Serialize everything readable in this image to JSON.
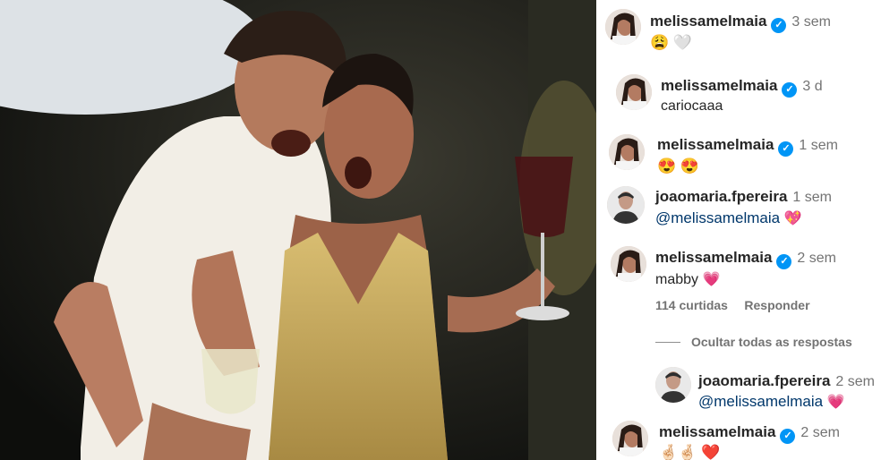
{
  "comments": [
    {
      "username": "melissamelmaia",
      "time": "3 sem",
      "text": "😩 🤍"
    },
    {
      "username": "melissamelmaia",
      "time": "3 d",
      "text": "cariocaaa"
    },
    {
      "username": "melissamelmaia",
      "time": "1 sem",
      "text": "😍 😍"
    },
    {
      "username": "joaomaria.fpereira",
      "time": "1 sem",
      "mention": "@melissamelmaia",
      "emoji": "💖"
    },
    {
      "username": "melissamelmaia",
      "time": "2 sem",
      "text": "mabby",
      "emoji": "💗",
      "likes": "114 curtidas",
      "reply": "Responder"
    },
    {
      "username": "joaomaria.fpereira",
      "time": "2 sem",
      "mention": "@melissamelmaia",
      "emoji": "💗"
    },
    {
      "username": "melissamelmaia",
      "time": "2 sem",
      "text": "🤞🏻🤞🏻 ❤️"
    }
  ],
  "hide_replies": "Ocultar todas as respostas",
  "colors": {
    "verified": "#0095f6",
    "mention": "#00376b",
    "heart": "#d6245d"
  },
  "icons": {
    "verified": "verified-badge-icon"
  }
}
